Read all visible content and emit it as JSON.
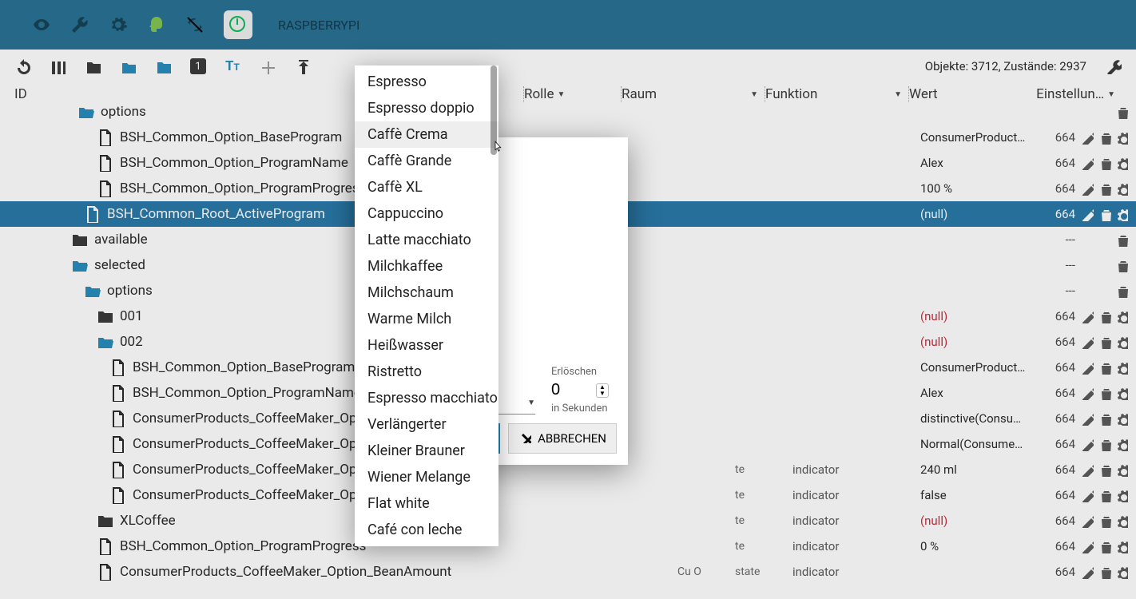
{
  "topbar": {
    "device": "RASPBERRYPI"
  },
  "toolbar": {
    "stats": "Objekte: 3712, Zustände: 2937"
  },
  "header": {
    "id": "ID",
    "rolle": "Rolle",
    "raum": "Raum",
    "funktion": "Funktion",
    "wert": "Wert",
    "einstell": "Einstellun…"
  },
  "tree": [
    {
      "indent": 96,
      "type": "folder-open",
      "name": "options",
      "wert": "",
      "ack": "",
      "actions": [
        "del"
      ],
      "cut": true
    },
    {
      "indent": 120,
      "type": "file",
      "name": "BSH_Common_Option_BaseProgram",
      "wert": "ConsumerProduct…",
      "ack": "664",
      "actions": [
        "edit",
        "del",
        "gear"
      ]
    },
    {
      "indent": 120,
      "type": "file",
      "name": "BSH_Common_Option_ProgramName",
      "wert": "Alex",
      "ack": "664",
      "actions": [
        "edit",
        "del",
        "gear"
      ]
    },
    {
      "indent": 120,
      "type": "file",
      "name": "BSH_Common_Option_ProgramProgress",
      "wert": "100 %",
      "ack": "664",
      "actions": [
        "edit",
        "del",
        "gear"
      ]
    },
    {
      "indent": 104,
      "type": "file",
      "name": "BSH_Common_Root_ActiveProgram",
      "sel": true,
      "wert": "(null)",
      "ack": "664",
      "actions": [
        "edit",
        "del",
        "gear"
      ]
    },
    {
      "indent": 88,
      "type": "folder",
      "name": "available",
      "wert": "",
      "ack": "---",
      "actions": [
        "del"
      ]
    },
    {
      "indent": 88,
      "type": "folder-open",
      "name": "selected",
      "wert": "",
      "ack": "---",
      "actions": [
        "del"
      ]
    },
    {
      "indent": 104,
      "type": "folder-open",
      "name": "options",
      "wert": "",
      "ack": "---",
      "actions": [
        "del"
      ]
    },
    {
      "indent": 120,
      "type": "folder",
      "name": "001",
      "wert": "(null)",
      "red": true,
      "ack": "664",
      "actions": [
        "edit",
        "del",
        "gear"
      ]
    },
    {
      "indent": 120,
      "type": "folder-open",
      "name": "002",
      "wert": "(null)",
      "red": true,
      "ack": "664",
      "actions": [
        "edit",
        "del",
        "gear"
      ]
    },
    {
      "indent": 136,
      "type": "file",
      "name": "BSH_Common_Option_BaseProgram",
      "wert": "ConsumerProduct…",
      "ack": "664",
      "actions": [
        "edit",
        "del",
        "gear"
      ]
    },
    {
      "indent": 136,
      "type": "file",
      "name": "BSH_Common_Option_ProgramName",
      "wert": "Alex",
      "ack": "664",
      "actions": [
        "edit",
        "del",
        "gear"
      ]
    },
    {
      "indent": 136,
      "type": "file",
      "name": "ConsumerProducts_CoffeeMaker_Optio",
      "wert": "distinctive(Consu…",
      "ack": "664",
      "actions": [
        "edit",
        "del",
        "gear"
      ]
    },
    {
      "indent": 136,
      "type": "file",
      "name": "ConsumerProducts_CoffeeMaker_Optio",
      "wert": "Normal(Consume…",
      "ack": "664",
      "actions": [
        "edit",
        "del",
        "gear"
      ]
    },
    {
      "indent": 136,
      "type": "file",
      "name": "ConsumerProducts_CoffeeMaker_Optio",
      "state": "te",
      "role": "indicator",
      "wert": "240 ml",
      "ack": "664",
      "actions": [
        "edit",
        "del",
        "gear"
      ]
    },
    {
      "indent": 136,
      "type": "file",
      "name": "ConsumerProducts_CoffeeMaker_Optio",
      "state": "te",
      "role": "indicator",
      "wert": "false",
      "ack": "664",
      "actions": [
        "edit",
        "del",
        "gear"
      ]
    },
    {
      "indent": 120,
      "type": "folder",
      "name": "XLCoffee",
      "state": "te",
      "role": "indicator",
      "wert": "(null)",
      "red": true,
      "ack": "664",
      "actions": [
        "edit",
        "del",
        "gear"
      ]
    },
    {
      "indent": 120,
      "type": "file",
      "name": "BSH_Common_Option_ProgramProgress",
      "state": "te",
      "role": "indicator",
      "wert": "0 %",
      "ack": "664",
      "actions": [
        "edit",
        "del",
        "gear"
      ]
    },
    {
      "indent": 120,
      "type": "file",
      "name": "ConsumerProducts_CoffeeMaker_Option_BeanAmount",
      "state_s": "Cu O",
      "state": "state",
      "role": "indicator",
      "wert": "",
      "ack": "664",
      "actions": [
        "edit",
        "del",
        "gear"
      ]
    }
  ],
  "dialog": {
    "erase_label": "Erlöschen",
    "erase_value": "0",
    "unit": "in Sekunden",
    "cancel": "ABBRECHEN"
  },
  "menu": {
    "items": [
      "Espresso",
      "Espresso doppio",
      "Caffè Crema",
      "Caffè Grande",
      "Caffè XL",
      "Cappuccino",
      "Latte macchiato",
      "Milchkaffee",
      "Milchschaum",
      "Warme Milch",
      "Heißwasser",
      "Ristretto",
      "Espresso macchiato",
      "Verlängerter",
      "Kleiner Brauner",
      "Wiener Melange",
      "Flat white",
      "Café con leche"
    ],
    "hover_index": 2
  }
}
